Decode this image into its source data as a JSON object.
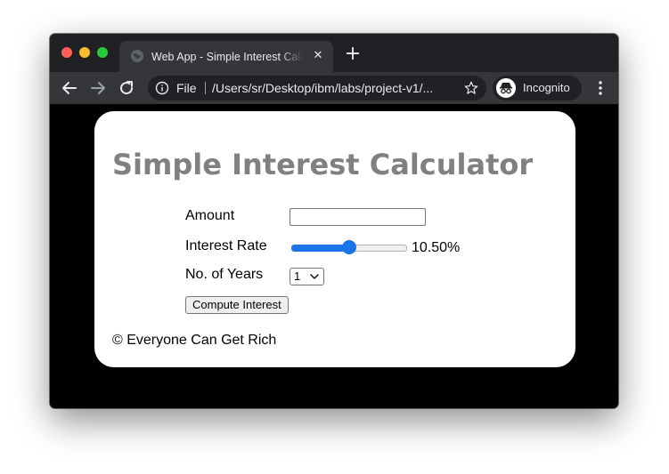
{
  "browser": {
    "tab": {
      "title": "Web App - Simple Interest Calculator",
      "close_glyph": "✕",
      "favicon": "globe-icon"
    },
    "new_tab_glyph": "+",
    "toolbar": {
      "back_icon": "arrow-left-icon",
      "forward_icon": "arrow-right-icon",
      "reload_icon": "reload-icon",
      "omnibox": {
        "scheme_label": "File",
        "url": "/Users/sr/Desktop/ibm/labs/project-v1/...",
        "info_icon": "info-icon",
        "bookmark_icon": "star-icon"
      },
      "profile_label": "Incognito",
      "menu_icon": "kebab-menu-icon"
    }
  },
  "page": {
    "title": "Simple Interest Calculator",
    "form": {
      "amount": {
        "label": "Amount",
        "value": ""
      },
      "rate": {
        "label": "Interest Rate",
        "display": "10.50%",
        "slider_fraction": 0.5
      },
      "years": {
        "label": "No. of Years",
        "selected": "1"
      },
      "compute_label": "Compute Interest"
    },
    "footer": "© Everyone Can Get Rich"
  },
  "colors": {
    "page_bg": "#000000",
    "card_bg": "#ffffff",
    "title": "#808080",
    "accent": "#1a73e8"
  }
}
